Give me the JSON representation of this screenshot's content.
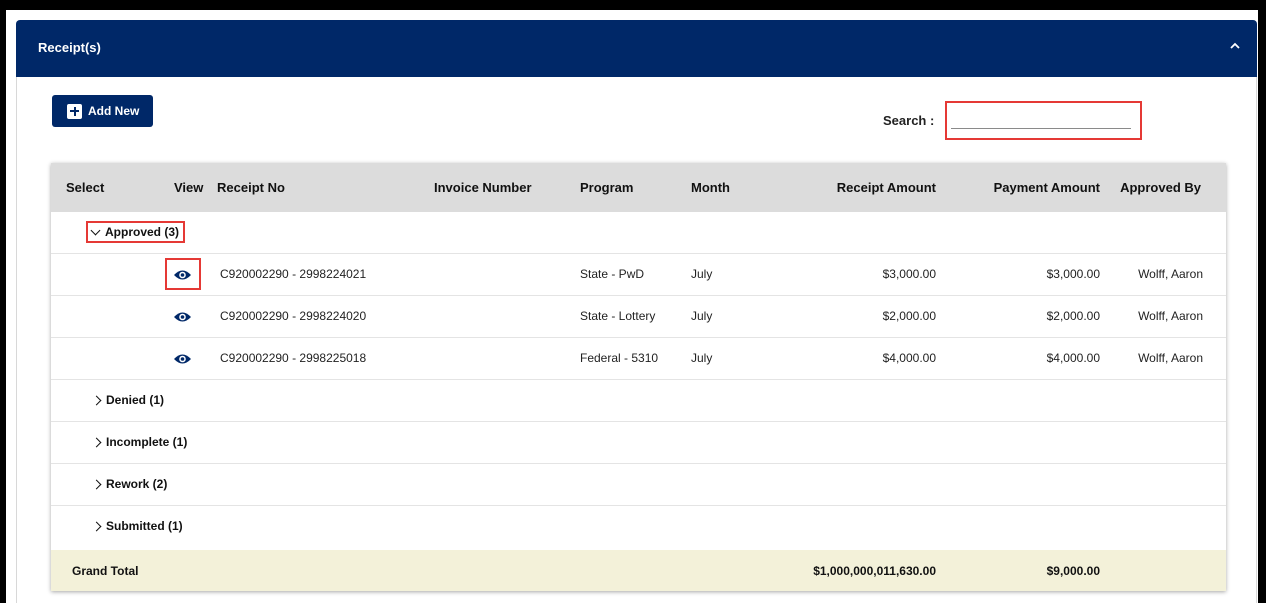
{
  "panel": {
    "title": "Receipt(s)",
    "collapse_icon": "chevron-up-icon"
  },
  "toolbar": {
    "add_label": "Add New",
    "search_label": "Search :",
    "search_value": "",
    "search_placeholder": ""
  },
  "columns": [
    "Select",
    "View",
    "Receipt No",
    "Invoice Number",
    "Program",
    "Month",
    "Receipt Amount",
    "Payment Amount",
    "Approved By"
  ],
  "groups": [
    {
      "label": "Approved (3)",
      "expanded": true
    },
    {
      "label": "Denied (1)",
      "expanded": false
    },
    {
      "label": "Incomplete (1)",
      "expanded": false
    },
    {
      "label": "Rework (2)",
      "expanded": false
    },
    {
      "label": "Submitted (1)",
      "expanded": false
    }
  ],
  "approved_rows": [
    {
      "receipt_no": "C920002290 - 2998224021",
      "invoice_number": "",
      "program": "State - PwD",
      "month": "July",
      "receipt_amount": "$3,000.00",
      "payment_amount": "$3,000.00",
      "approved_by": "Wolff, Aaron"
    },
    {
      "receipt_no": "C920002290 - 2998224020",
      "invoice_number": "",
      "program": "State - Lottery",
      "month": "July",
      "receipt_amount": "$2,000.00",
      "payment_amount": "$2,000.00",
      "approved_by": "Wolff, Aaron"
    },
    {
      "receipt_no": "C920002290 - 2998225018",
      "invoice_number": "",
      "program": "Federal - 5310",
      "month": "July",
      "receipt_amount": "$4,000.00",
      "payment_amount": "$4,000.00",
      "approved_by": "Wolff, Aaron"
    }
  ],
  "grand_total": {
    "label": "Grand Total",
    "receipt_amount": "$1,000,000,011,630.00",
    "payment_amount": "$9,000.00"
  },
  "colors": {
    "header_bg": "#002868",
    "highlight": "#e53935",
    "total_bg": "#f3f1d9",
    "table_head_bg": "#dcdcdc"
  }
}
